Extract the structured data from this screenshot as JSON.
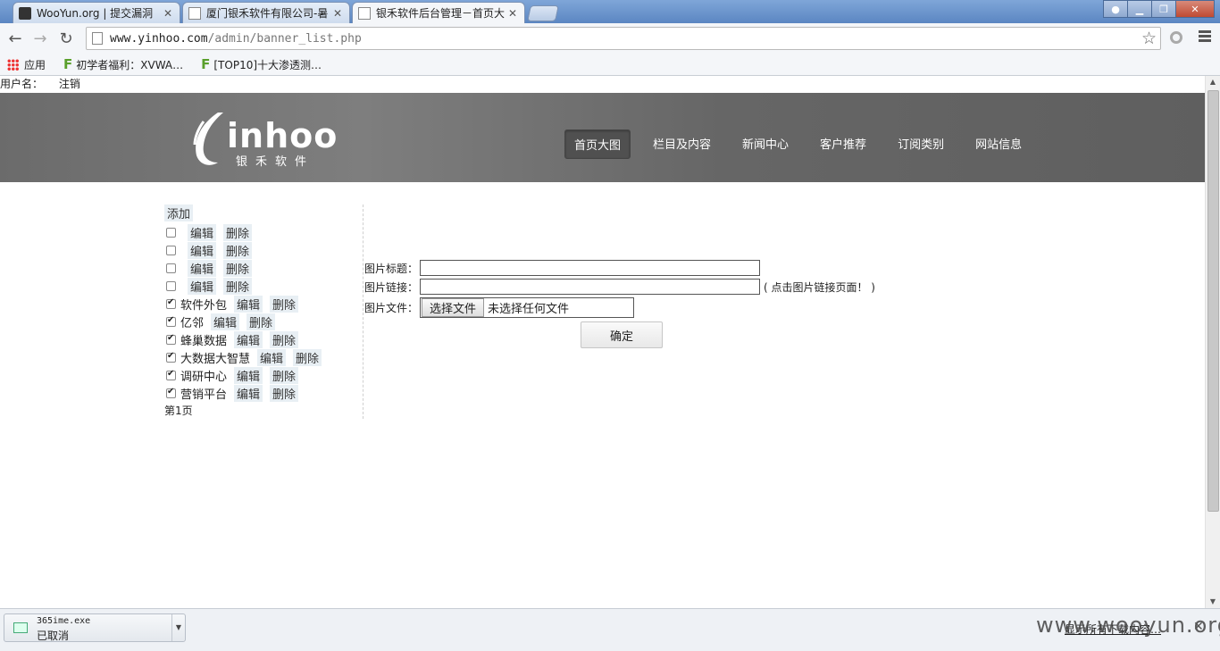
{
  "browser": {
    "tabs": [
      {
        "title": "WooYun.org | 提交漏洞",
        "active": false
      },
      {
        "title": "厦门银禾软件有限公司-暑",
        "active": false
      },
      {
        "title": "银禾软件后台管理－首页大",
        "active": true
      }
    ],
    "address": {
      "host": "www.yinhoo.com",
      "path": "/admin/banner_list.php"
    },
    "bookmarks": [
      {
        "label": "应用"
      },
      {
        "label": "初学者福利：XVWA…"
      },
      {
        "label": "[TOP10]十大渗透测…"
      }
    ]
  },
  "page": {
    "userbar": {
      "username_label": "用户名：",
      "logout": "注销"
    },
    "logo": {
      "word": "inhoo",
      "sub": "银禾软件"
    },
    "nav": [
      {
        "label": "首页大图",
        "active": true
      },
      {
        "label": "栏目及内容",
        "active": false
      },
      {
        "label": "新闻中心",
        "active": false
      },
      {
        "label": "客户推荐",
        "active": false
      },
      {
        "label": "订阅类别",
        "active": false
      },
      {
        "label": "网站信息",
        "active": false
      }
    ],
    "list": {
      "add": "添加",
      "edit": "编辑",
      "delete": "删除",
      "items": [
        {
          "name": "",
          "checked": false
        },
        {
          "name": "",
          "checked": false
        },
        {
          "name": "",
          "checked": false
        },
        {
          "name": "",
          "checked": false
        },
        {
          "name": "软件外包",
          "checked": true
        },
        {
          "name": "亿邻",
          "checked": true
        },
        {
          "name": "蜂巢数据",
          "checked": true
        },
        {
          "name": "大数据大智慧",
          "checked": true
        },
        {
          "name": "调研中心",
          "checked": true
        },
        {
          "name": "营销平台",
          "checked": true
        }
      ],
      "page_info": "第1页"
    },
    "form": {
      "title_label": "图片标题：",
      "title_value": "",
      "link_label": "图片链接：",
      "link_value": "",
      "link_hint": "( 点击图片链接页面！ )",
      "file_label": "图片文件：",
      "file_button": "选择文件",
      "file_status": "未选择任何文件",
      "submit": "确定"
    }
  },
  "downloads": {
    "file_name": "365ime.exe",
    "status": "已取消",
    "show_all": "显示所有下载内容…",
    "watermark": "www.wooyun.org"
  }
}
